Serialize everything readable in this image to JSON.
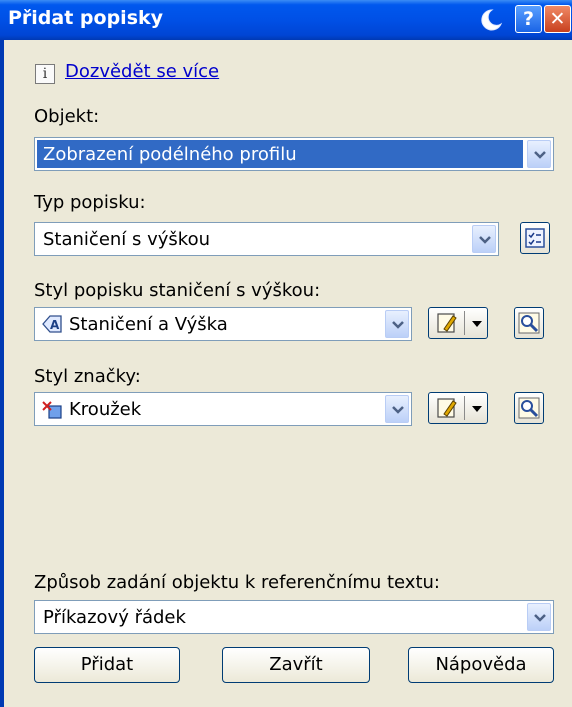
{
  "window": {
    "title": "Přidat popisky",
    "help_glyph": "?",
    "close_glyph": "✕"
  },
  "info": {
    "icon_glyph": "i",
    "link_text": "Dozvědět se více"
  },
  "object": {
    "label": "Objekt:",
    "value": "Zobrazení podélného profilu"
  },
  "label_type": {
    "label": "Typ popisku:",
    "value": "Staničení s výškou"
  },
  "label_style": {
    "label": "Styl popisku staničení s výškou:",
    "value": "Staničení a Výška"
  },
  "marker_style": {
    "label": "Styl značky:",
    "value": "Kroužek"
  },
  "reference": {
    "label": "Způsob zadání objektu k referenčnímu textu:",
    "value": "Příkazový řádek"
  },
  "buttons": {
    "add": "Přidat",
    "close": "Zavřít",
    "help": "Nápověda"
  },
  "colors": {
    "titlebar": "#0050e6",
    "dialog_bg": "#ece9d8",
    "selected_bg": "#316ac5",
    "link": "#0000cc"
  }
}
